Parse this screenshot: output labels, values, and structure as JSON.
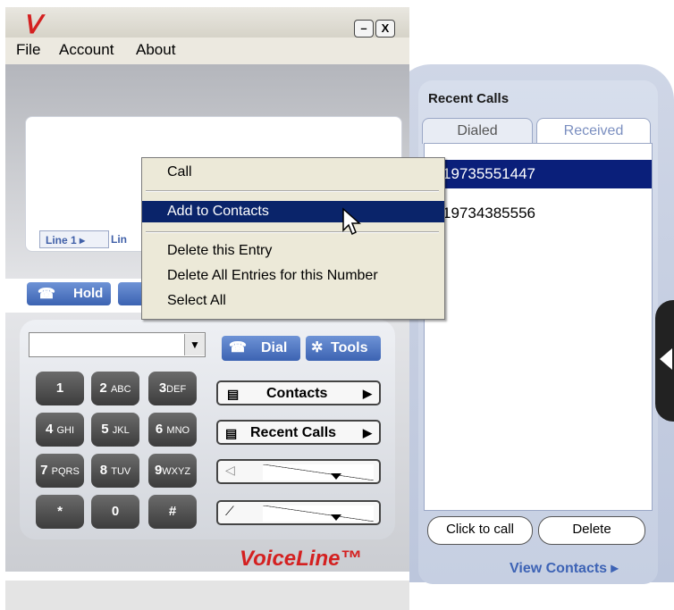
{
  "app": {
    "logo_glyph": "ᐯ",
    "brand": "VoiceLine™"
  },
  "window_controls": {
    "minimize_label": "–",
    "close_label": "X"
  },
  "menu": {
    "file": "File",
    "account": "Account",
    "about": "About"
  },
  "lines": {
    "line1": "Line 1 ▸",
    "line2": "Lin"
  },
  "controls": {
    "hold": "Hold",
    "dial": "Dial",
    "tools": "Tools",
    "dropdown_arrow": "▼",
    "contacts": "Contacts",
    "recent_calls": "Recent Calls",
    "arrow": "▶"
  },
  "keypad": [
    {
      "main": "1",
      "sub": ""
    },
    {
      "main": "2",
      "sub": "ABC"
    },
    {
      "main": "3",
      "sub": "DEF"
    },
    {
      "main": "4",
      "sub": "GHI"
    },
    {
      "main": "5",
      "sub": "JKL"
    },
    {
      "main": "6",
      "sub": "MNO"
    },
    {
      "main": "7",
      "sub": "PQRS"
    },
    {
      "main": "8",
      "sub": "TUV"
    },
    {
      "main": "9",
      "sub": "WXYZ"
    },
    {
      "main": "*",
      "sub": ""
    },
    {
      "main": "0",
      "sub": ""
    },
    {
      "main": "#",
      "sub": ""
    }
  ],
  "recent_calls": {
    "title": "Recent Calls",
    "tabs": {
      "dialed": "Dialed",
      "received": "Received"
    },
    "active_tab": "Received",
    "entries": [
      "19735551447",
      "19734385556"
    ],
    "selected_index": 0,
    "click_to_call": "Click to call",
    "delete": "Delete",
    "view_contacts": "View Contacts ▸"
  },
  "context_menu": {
    "items": [
      "Call",
      "Add to Contacts",
      "Delete this Entry",
      "Delete All Entries for this Number",
      "Select All"
    ],
    "highlighted": "Add to Contacts"
  },
  "colors": {
    "accent_blue": "#3c63b2",
    "selection": "#0a1f7a",
    "brand_red": "#d42020"
  }
}
